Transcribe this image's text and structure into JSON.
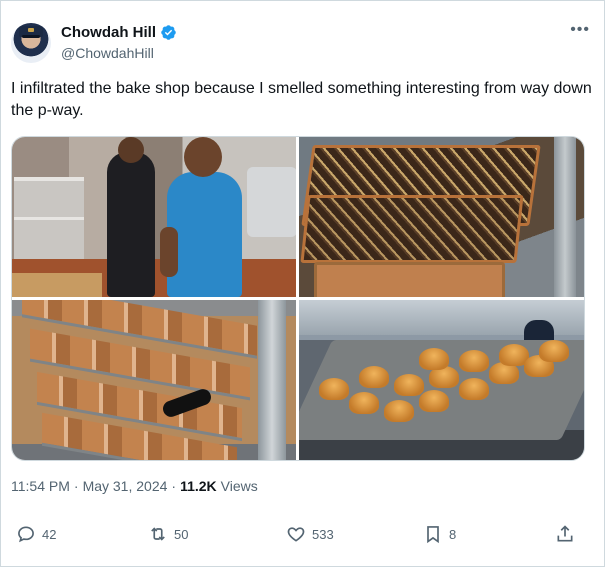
{
  "author": {
    "name": "Chowdah Hill",
    "handle": "@ChowdahHill",
    "verified": true
  },
  "tweet": {
    "text": "I infiltrated the bake shop because I smelled something interesting from way down the p-way."
  },
  "media": [
    {
      "name": "photo-bakers"
    },
    {
      "name": "photo-baklava-trays"
    },
    {
      "name": "photo-cinnamon-rolls-rack"
    },
    {
      "name": "photo-muffins-tray"
    }
  ],
  "meta": {
    "time": "11:54 PM",
    "sep1": "·",
    "date": "May 31, 2024",
    "sep2": "·",
    "views_count": "11.2K",
    "views_label": "Views"
  },
  "actions": {
    "replies": "42",
    "reposts": "50",
    "likes": "533",
    "bookmarks": "8"
  },
  "colors": {
    "text_primary": "#0f1419",
    "text_secondary": "#536471",
    "verified": "#1d9bf0",
    "border": "#cfd9de"
  }
}
